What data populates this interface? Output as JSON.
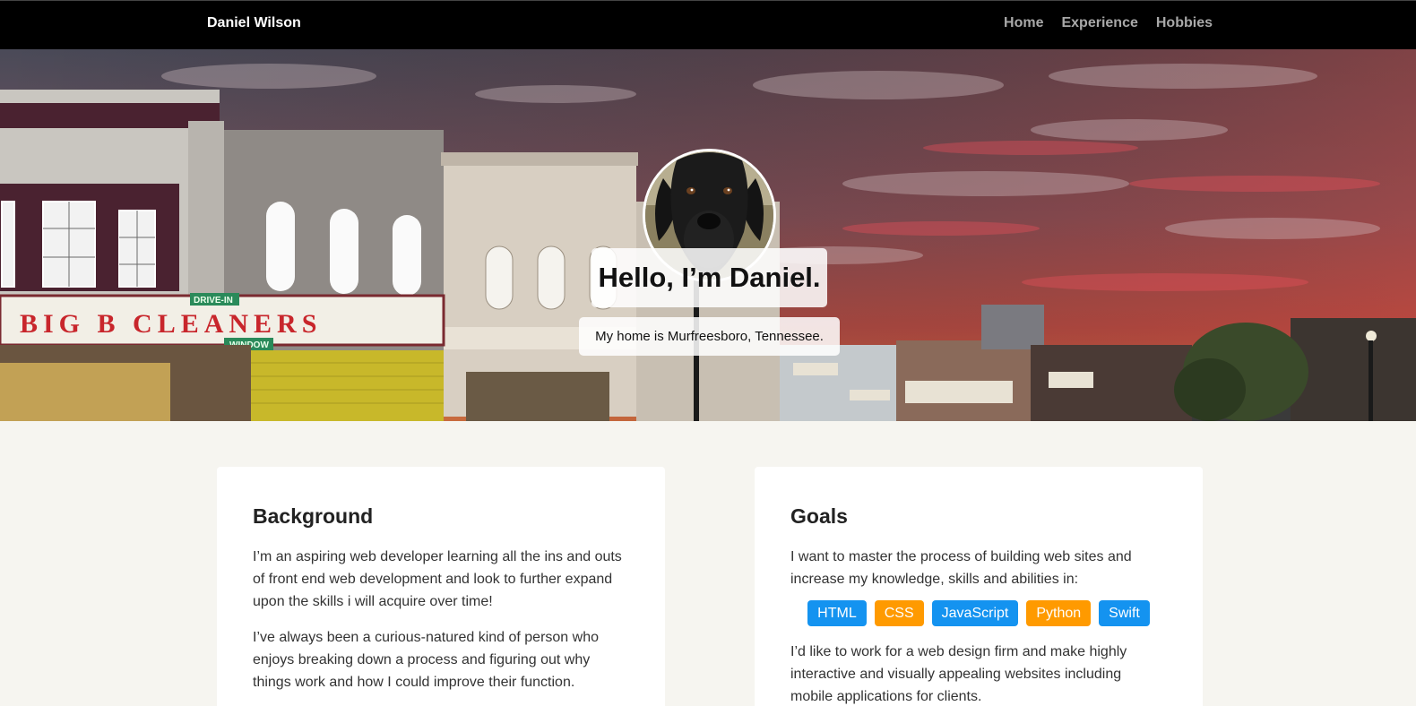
{
  "header": {
    "brand": "Daniel Wilson",
    "nav": [
      "Home",
      "Experience",
      "Hobbies"
    ]
  },
  "hero": {
    "greeting": "Hello, I’m Daniel.",
    "subline": "My home is Murfreesboro, Tennessee.",
    "storefront_sign": "BIG B CLEANERS",
    "storefront_small_signs": [
      "DRIVE-IN",
      "WINDOW"
    ]
  },
  "background_card": {
    "title": "Background",
    "paragraphs": [
      "I’m an aspiring web developer learning all the ins and outs of front end web development and look to further expand upon the skills i will acquire over time!",
      "I’ve always been a curious-natured kind of person who enjoys breaking down a process and figuring out why things work and how I could improve their function."
    ]
  },
  "goals_card": {
    "title": "Goals",
    "intro": "I want to master the process of building web sites and increase my knowledge, skills and abilities in:",
    "skills": [
      {
        "label": "HTML",
        "color": "#1493f0"
      },
      {
        "label": "CSS",
        "color": "#ff9a00"
      },
      {
        "label": "JavaScript",
        "color": "#1493f0"
      },
      {
        "label": "Python",
        "color": "#ff9a00"
      },
      {
        "label": "Swift",
        "color": "#1493f0"
      }
    ],
    "outro": "I’d like to work for a web design firm and make highly interactive and visually appealing websites including mobile applications for clients."
  },
  "colors": {
    "navbar": "#000000",
    "page_background": "#f6f5f0",
    "skill_blue": "#1493f0",
    "skill_orange": "#ff9a00"
  }
}
